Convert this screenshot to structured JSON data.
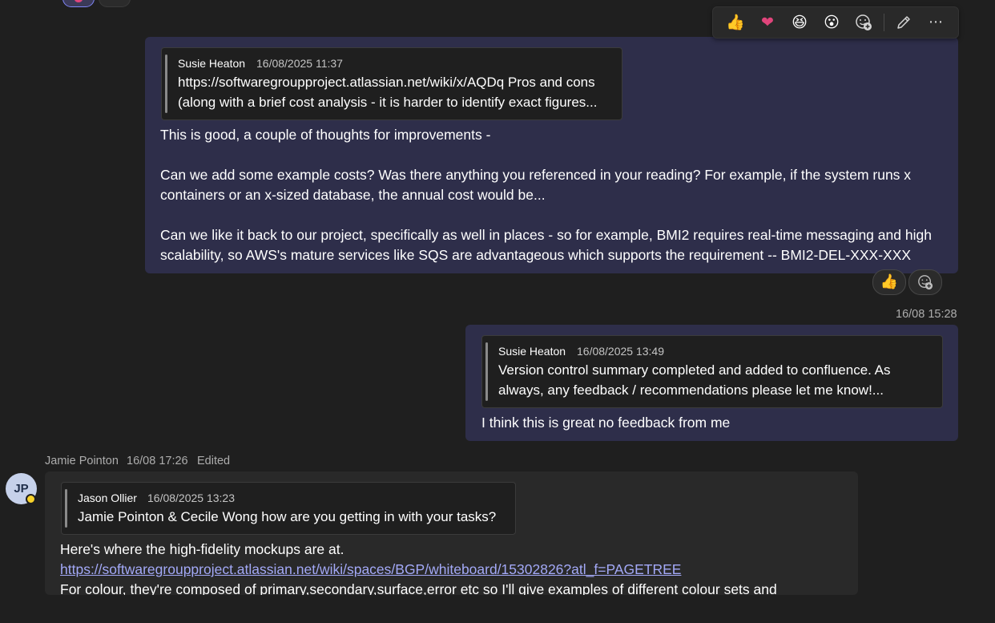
{
  "reaction_toolbar": {
    "emojis": [
      "👍",
      "❤",
      "😆",
      "😮"
    ],
    "add_reaction_icon": "add-reaction-icon",
    "edit_icon": "pencil-icon",
    "more_icon": "more-options-icon",
    "more_glyph": "⋯"
  },
  "message1": {
    "quote": {
      "author": "Susie Heaton",
      "time": "16/08/2025 11:37",
      "line1": "https://softwaregroupproject.atlassian.net/wiki/x/AQDq Pros and cons",
      "line2": "(along with a brief cost analysis - it is harder to identify exact figures..."
    },
    "lines": [
      "This is good, a couple of thoughts for improvements -",
      "Can we add some example costs? Was there anything you referenced in your reading? For example, if the system runs x",
      "containers or an x-sized database, the annual cost would be...",
      "Can we like it back to our project, specifically as well in places - so for example, BMI2 requires real-time messaging and high",
      "scalability, so AWS's mature services like SQS are advantageous which supports the requirement -- BMI2-DEL-XXX-XXX"
    ],
    "reaction": "👍"
  },
  "message2": {
    "time": "16/08 15:28",
    "quote": {
      "author": "Susie Heaton",
      "time": "16/08/2025 13:49",
      "line1": "Version control summary completed and added to confluence. As",
      "line2": "always, any feedback / recommendations please let me know!..."
    },
    "text": "I think this is great no feedback from me"
  },
  "message3": {
    "author": "Jamie Pointon",
    "time": "16/08 17:26",
    "edited": "Edited",
    "avatar_initials": "JP",
    "quote": {
      "author": "Jason Ollier",
      "time": "16/08/2025 13:23",
      "line1": "Jamie Pointon & Cecile Wong how are you getting in with your tasks?"
    },
    "line1": "Here's where the high-fidelity mockups are at.",
    "link": "https://softwaregroupproject.atlassian.net/wiki/spaces/BGP/whiteboard/15302826?atl_f=PAGETREE",
    "line3": " For colour, they're composed of primary,secondary,surface,error etc so I'll give examples of different colour sets and"
  }
}
